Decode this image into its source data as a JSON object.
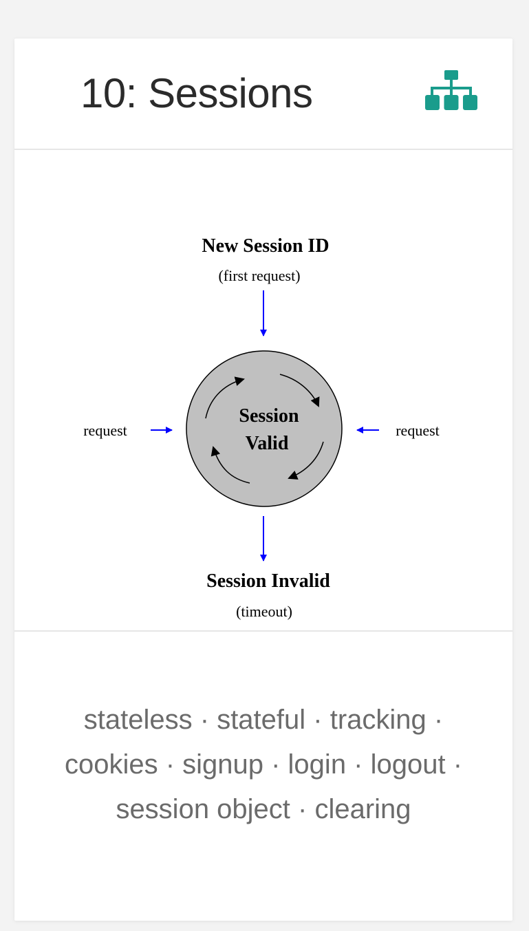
{
  "card": {
    "title": "10: Sessions",
    "icon": "sitemap-icon",
    "accent_color": "#1a9c8c"
  },
  "diagram": {
    "top_label": "New Session ID",
    "top_sublabel": "(first request)",
    "circle_line1": "Session",
    "circle_line2": "Valid",
    "left_label": "request",
    "right_label": "request",
    "bottom_label": "Session Invalid",
    "bottom_sublabel": "(timeout)",
    "arrow_color": "#0000ff",
    "circle_color": "#c0c0c0"
  },
  "tags": [
    "stateless",
    "stateful",
    "tracking",
    "cookies",
    "signup",
    "login",
    "logout",
    "session object",
    "clearing"
  ],
  "tag_separator": " · "
}
